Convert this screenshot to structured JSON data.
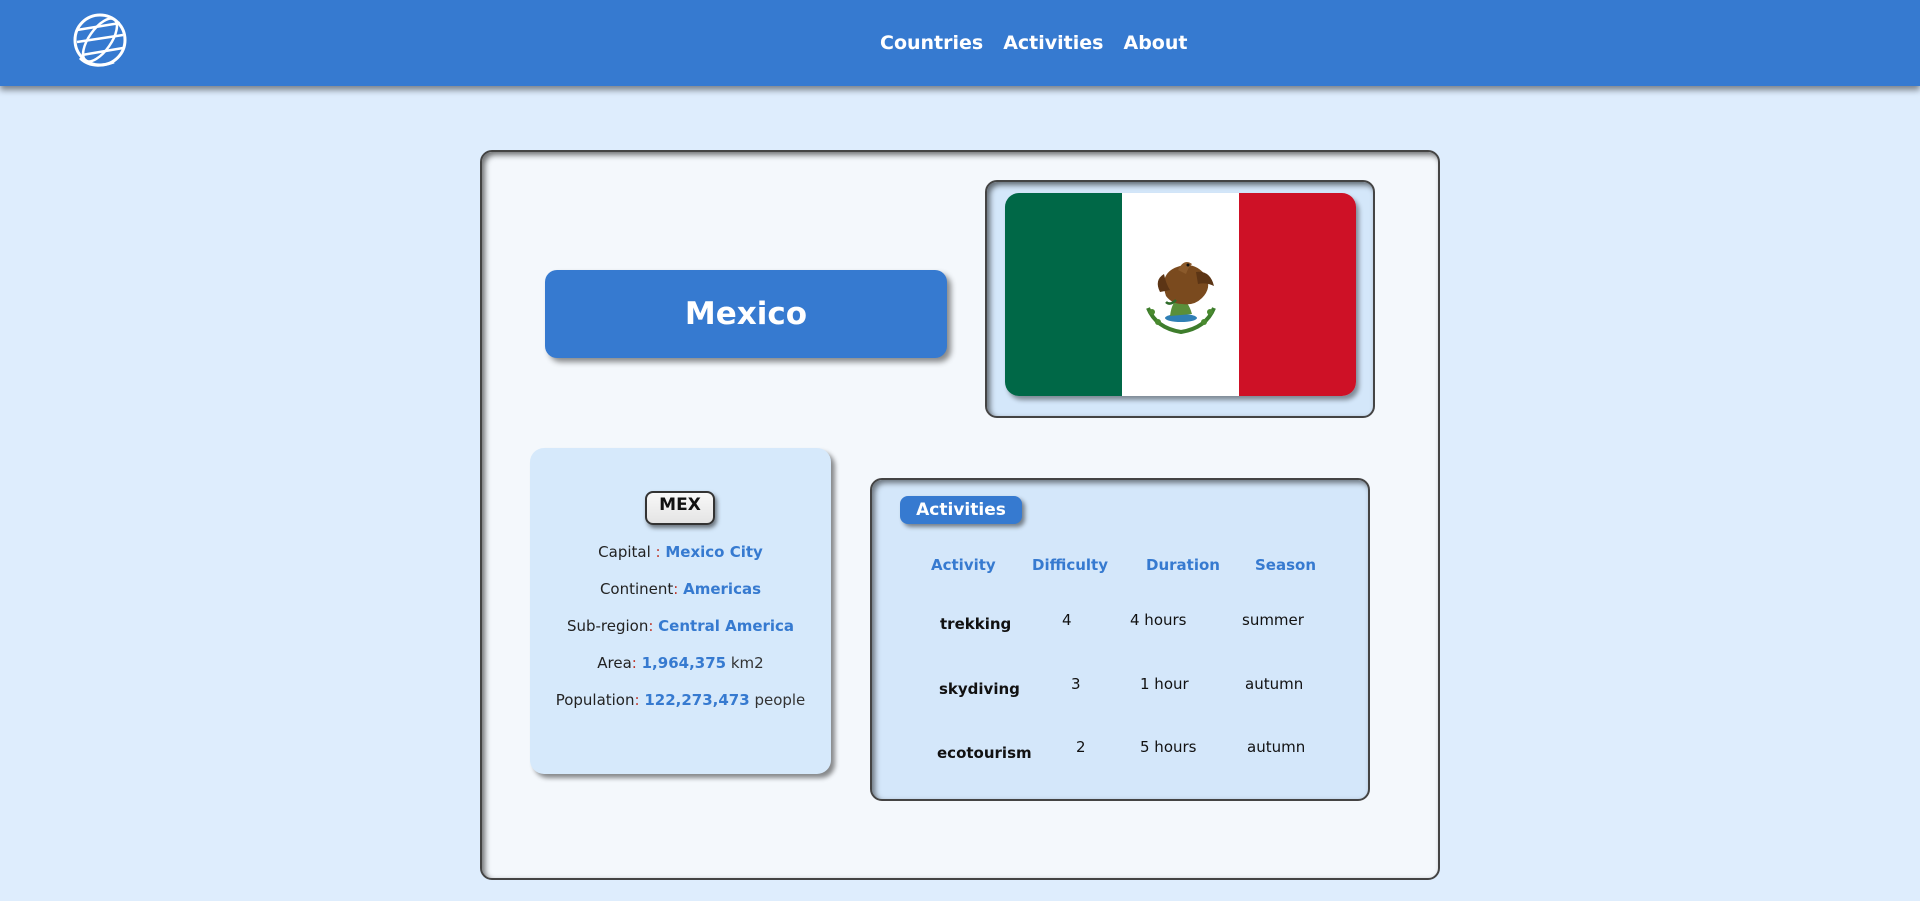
{
  "nav": {
    "logo_icon": "globe-icon",
    "links": [
      "Countries",
      "Activities",
      "About"
    ]
  },
  "country": {
    "name": "Mexico",
    "code": "MEX",
    "flag": {
      "colors": [
        "#006847",
        "#ffffff",
        "#ce1126"
      ],
      "emblem_icon": "eagle-emblem-icon"
    },
    "info": {
      "capital_label": "Capital",
      "capital_sep": " : ",
      "capital": "Mexico City",
      "continent_label": "Continent",
      "continent_sep": ": ",
      "continent": "Americas",
      "subregion_label": "Sub-region",
      "subregion_sep": ": ",
      "subregion": "Central America",
      "area_label": "Area",
      "area_sep": ": ",
      "area": "1,964,375",
      "area_unit": " km2",
      "population_label": "Population",
      "population_sep": ": ",
      "population": "122,273,473",
      "population_unit": " people"
    }
  },
  "activities": {
    "title": "Activities",
    "headers": {
      "activity": "Activity",
      "difficulty": "Difficulty",
      "duration": "Duration",
      "season": "Season"
    },
    "rows": [
      {
        "name": "trekking",
        "difficulty": "4",
        "duration": "4 hours",
        "season": "summer"
      },
      {
        "name": "skydiving",
        "difficulty": "3",
        "duration": "1 hour",
        "season": "autumn"
      },
      {
        "name": "ecotourism",
        "difficulty": "2",
        "duration": "5 hours",
        "season": "autumn"
      }
    ]
  },
  "colors": {
    "accent": "#367ad0",
    "page_bg": "#deedfd",
    "card_bg": "#f4f8fc",
    "panel_bg": "#d6e9fb"
  }
}
